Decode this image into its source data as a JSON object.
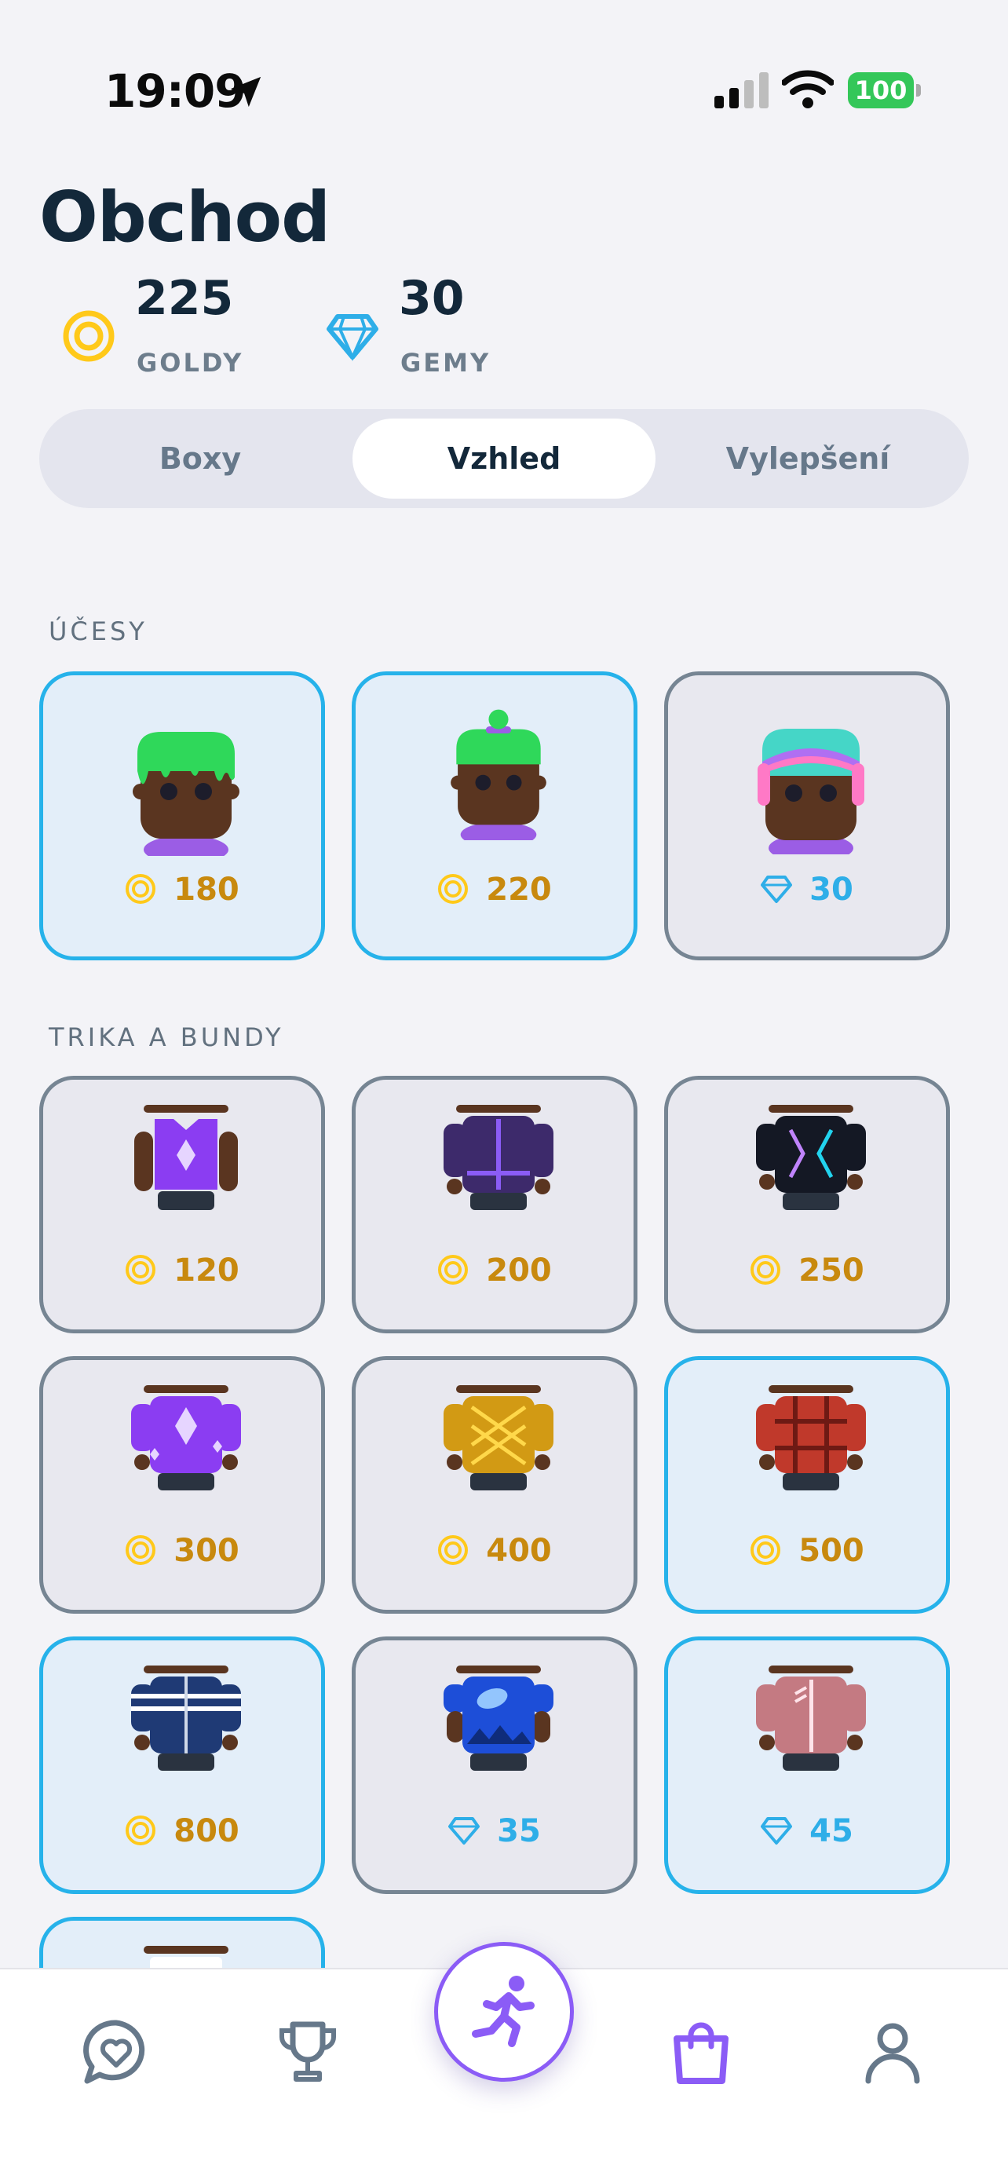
{
  "status_bar": {
    "time": "19:09",
    "battery": "100"
  },
  "page": {
    "title": "Obchod"
  },
  "currencies": [
    {
      "amount": "225",
      "label": "GOLDY",
      "icon": "gold-coin-icon"
    },
    {
      "amount": "30",
      "label": "GEMY",
      "icon": "gem-icon"
    }
  ],
  "tabs": [
    {
      "label": "Boxy",
      "active": false
    },
    {
      "label": "Vzhled",
      "active": true
    },
    {
      "label": "Vylepšení",
      "active": false
    }
  ],
  "sections": [
    {
      "title": "ÚČESY",
      "items": [
        {
          "price": "180",
          "currency": "gold",
          "art": "green-slime-hair"
        },
        {
          "price": "220",
          "currency": "gold",
          "art": "green-beanie-hair"
        },
        {
          "price": "30",
          "currency": "gem",
          "art": "rainbow-hair"
        }
      ]
    },
    {
      "title": "TRIKA A BUNDY",
      "items": [
        {
          "price": "120",
          "currency": "gold",
          "art": "purple-diamond-vest"
        },
        {
          "price": "200",
          "currency": "gold",
          "art": "dark-purple-jacket"
        },
        {
          "price": "250",
          "currency": "gold",
          "art": "black-neon-jacket"
        },
        {
          "price": "300",
          "currency": "gold",
          "art": "purple-crystal-shirt"
        },
        {
          "price": "400",
          "currency": "gold",
          "art": "yellow-laced-shirt"
        },
        {
          "price": "500",
          "currency": "gold",
          "art": "red-plaid-shirt"
        },
        {
          "price": "800",
          "currency": "gold",
          "art": "navy-track-jacket"
        },
        {
          "price": "35",
          "currency": "gem",
          "art": "blue-mountain-shirt"
        },
        {
          "price": "45",
          "currency": "gem",
          "art": "pink-zip-jacket"
        }
      ]
    }
  ],
  "nav": [
    {
      "name": "chat-heart-icon"
    },
    {
      "name": "trophy-icon"
    },
    {
      "name": "run-icon"
    },
    {
      "name": "shopping-bag-icon"
    },
    {
      "name": "profile-icon"
    }
  ],
  "colors": {
    "accent": "#8b5cf6",
    "gold": "#c8890e",
    "gem": "#2eaee8",
    "highlight_border": "#26b2ea",
    "card_border": "#768593"
  }
}
